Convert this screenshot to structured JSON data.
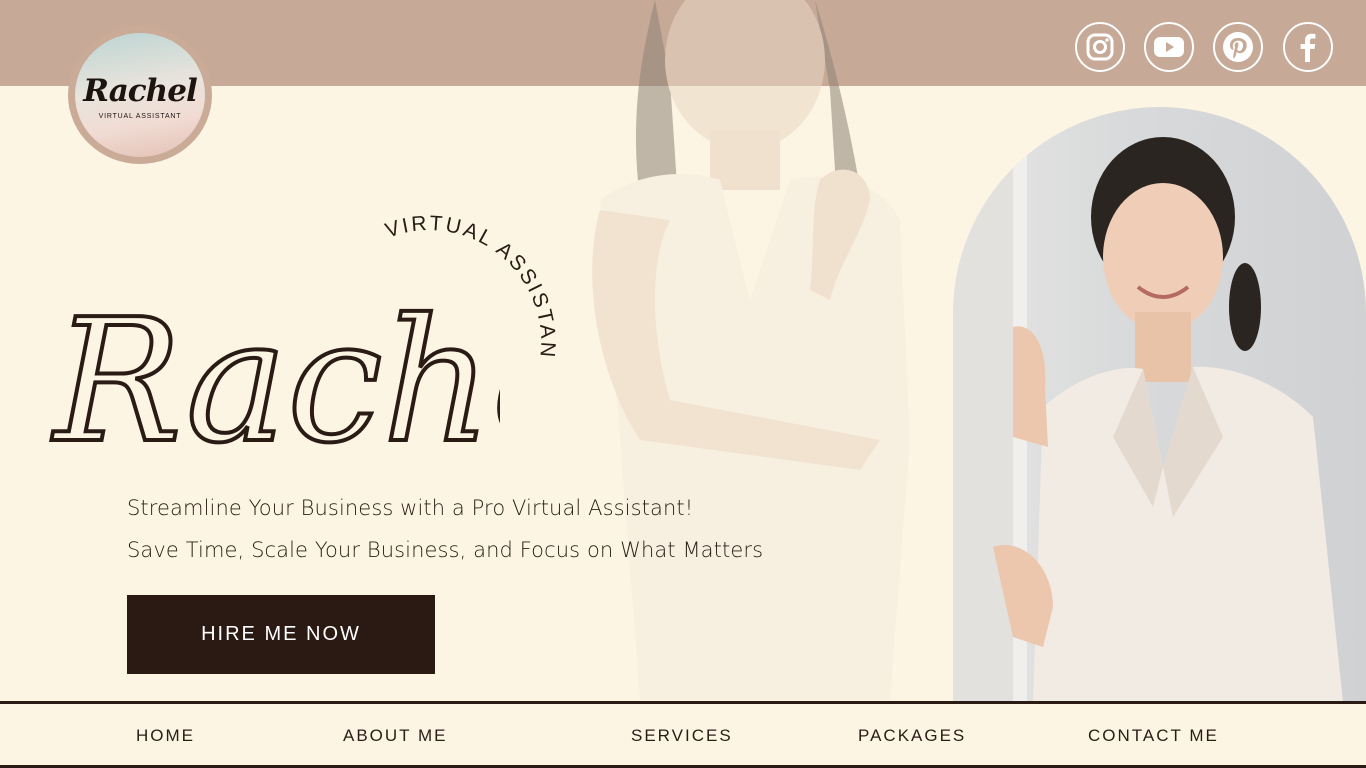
{
  "logo": {
    "script_text": "Rachel",
    "sub_text": "VIRTUAL ASSISTANT"
  },
  "social": [
    {
      "name": "instagram-icon",
      "label": "Instagram"
    },
    {
      "name": "youtube-icon",
      "label": "YouTube"
    },
    {
      "name": "pinterest-icon",
      "label": "Pinterest"
    },
    {
      "name": "facebook-icon",
      "label": "Facebook"
    }
  ],
  "hero": {
    "name": "Rachel",
    "arc_text": "VIRTUAL ASSISTANT",
    "tagline_1": "Streamline Your Business with a Pro Virtual Assistant!",
    "tagline_2": "Save Time, Scale Your Business, and Focus on What Matters",
    "cta_label": "HIRE ME NOW"
  },
  "nav": {
    "home": "HOME",
    "about": "ABOUT ME",
    "services": "SERVICES",
    "packages": "PACKAGES",
    "contact": "CONTACT ME"
  },
  "colors": {
    "background": "#fdf5e4",
    "top_band": "#c6a996",
    "dark": "#2b1a13",
    "accent_white": "#ffffff"
  }
}
